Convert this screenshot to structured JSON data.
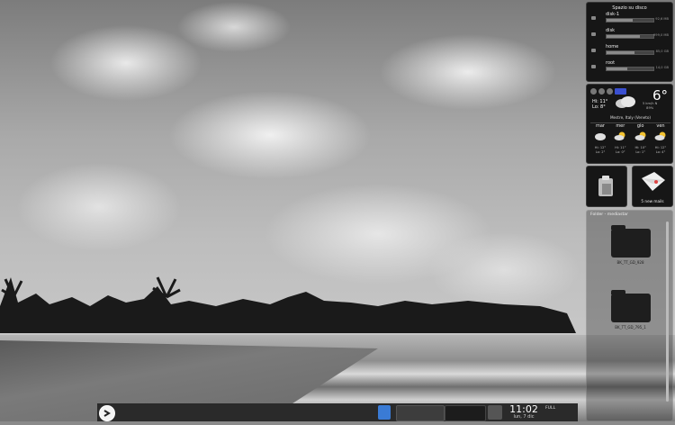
{
  "disk_widget": {
    "title": "Spazio su disco",
    "drives": [
      {
        "name": "disk-1",
        "size": "92,6 MB",
        "used": 0.55
      },
      {
        "name": "disk",
        "size": "999,0 MB",
        "used": 0.72
      },
      {
        "name": "home",
        "size": "85,0 GB",
        "used": 0.6
      },
      {
        "name": "root",
        "size": "14,0 GB",
        "used": 0.45
      }
    ]
  },
  "weather_widget": {
    "temperature": "6°",
    "high": "Hi: 11°",
    "low": "Lo: 8°",
    "wind": "5 km/h N",
    "humidity": "89%",
    "location": "Mestre, Italy (Veneto)",
    "days": [
      {
        "name": "mar",
        "icon": "cloudy-icon",
        "hi": "Hi: 12°",
        "lo": "Lo: 2°"
      },
      {
        "name": "mer",
        "icon": "partly-sunny-icon",
        "hi": "Hi: 11°",
        "lo": "Lo: 0°"
      },
      {
        "name": "gio",
        "icon": "partly-sunny-icon",
        "hi": "Hi: 10°",
        "lo": "Lo: 1°"
      },
      {
        "name": "ven",
        "icon": "partly-sunny-icon",
        "hi": "Hi: 12°",
        "lo": "Lo: 4°"
      }
    ]
  },
  "mail_widget": {
    "label": "5 new mails"
  },
  "folder_view": {
    "title": "Folder - mediastar",
    "items": [
      {
        "label": "BK_TT_GD_928"
      },
      {
        "label": "BK_TT_GD_795_1"
      }
    ]
  },
  "taskbar": {
    "time": "11:02",
    "date": "lun, 7 dic",
    "tray_text": "FULL"
  },
  "colors": {
    "accent": "#3a4fd0",
    "panel": "#161616"
  }
}
